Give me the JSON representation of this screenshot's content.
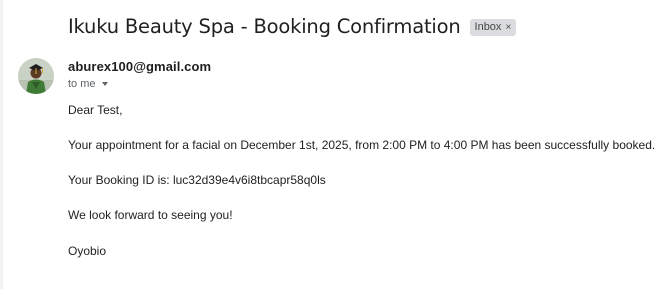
{
  "email": {
    "subject": "Ikuku Beauty Spa - Booking Confirmation",
    "label": "Inbox",
    "label_remove": "×",
    "sender": "aburex100@gmail.com",
    "recipient": "to me"
  },
  "message": {
    "greeting": "Dear Test,",
    "appointment": "Your appointment for a facial on December 1st, 2025, from 2:00 PM to 4:00 PM has been successfully booked.",
    "booking_id": "Your Booking ID is: luc32d39e4v6i8tbcapr58q0ls",
    "closing": "We look forward to seeing you!",
    "signature": "Oyobio"
  }
}
